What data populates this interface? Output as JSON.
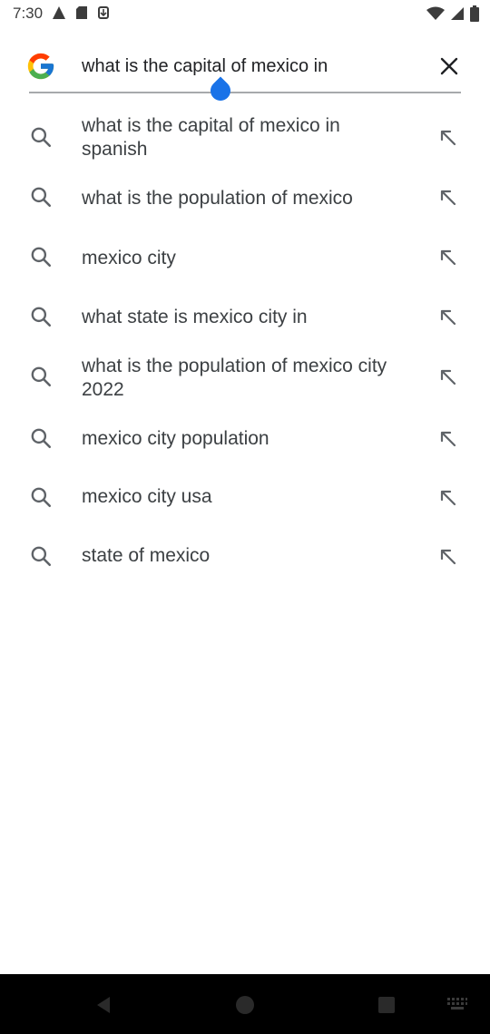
{
  "status": {
    "time": "7:30",
    "left_icons": [
      "alert-icon",
      "sd-card-icon",
      "download-icon"
    ],
    "right_icons": [
      "wifi-icon",
      "signal-icon",
      "battery-icon"
    ]
  },
  "search": {
    "query": "what is the capital of mexico in",
    "clear_icon": "close-icon",
    "accent_color": "#1a73e8"
  },
  "suggestions": [
    {
      "line1": "what is the capital of mexico in",
      "line2": "spanish"
    },
    {
      "line1": "what is the population of mexico",
      "line2": ""
    },
    {
      "line1": "mexico city",
      "line2": ""
    },
    {
      "line1": "what state is mexico city in",
      "line2": ""
    },
    {
      "line1": "what is the population of mexico city",
      "line2": "2022"
    },
    {
      "line1": "mexico city population",
      "line2": ""
    },
    {
      "line1": "mexico city usa",
      "line2": ""
    },
    {
      "line1": "state of mexico",
      "line2": ""
    }
  ],
  "nav": {
    "icons": [
      "back-icon",
      "home-icon",
      "recents-icon",
      "keyboard-icon"
    ]
  }
}
